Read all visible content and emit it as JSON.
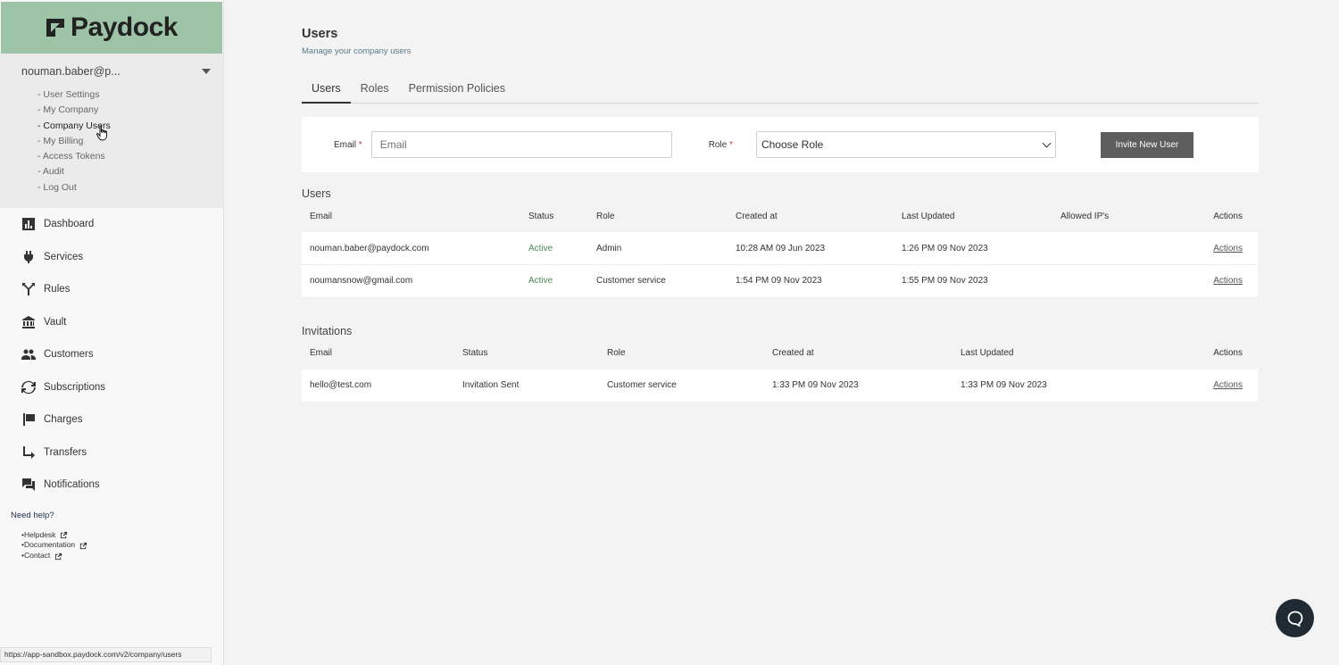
{
  "brand": {
    "name": "Paydock",
    "accent": "#9ec4a8"
  },
  "user": {
    "name": "nouman.baber@p...",
    "menu": [
      "- User Settings",
      "- My Company",
      "- Company Users",
      "- My Billing",
      "- Access Tokens",
      "- Audit",
      "- Log Out"
    ],
    "active_index": 2
  },
  "nav": [
    {
      "label": "Dashboard",
      "icon": "bar-chart-icon"
    },
    {
      "label": "Services",
      "icon": "plug-icon"
    },
    {
      "label": "Rules",
      "icon": "fork-icon"
    },
    {
      "label": "Vault",
      "icon": "bank-icon"
    },
    {
      "label": "Customers",
      "icon": "people-icon"
    },
    {
      "label": "Subscriptions",
      "icon": "refresh-icon"
    },
    {
      "label": "Charges",
      "icon": "flag-icon"
    },
    {
      "label": "Transfers",
      "icon": "transfer-arrow-icon"
    },
    {
      "label": "Notifications",
      "icon": "chat-bubbles-icon"
    }
  ],
  "help": {
    "title": "Need help?",
    "links": [
      "Helpdesk",
      "Documentation",
      "Contact"
    ]
  },
  "status_url": "https://app-sandbox.paydock.com/v2/company/users",
  "page": {
    "title": "Users",
    "subtitle": "Manage your company users",
    "tabs": [
      "Users",
      "Roles",
      "Permission Policies"
    ],
    "active_tab": 0
  },
  "invite": {
    "email_label": "Email",
    "email_placeholder": "Email",
    "role_label": "Role",
    "role_selected": "Choose Role",
    "button": "Invite New User"
  },
  "users": {
    "title": "Users",
    "columns": [
      "Email",
      "Status",
      "Role",
      "Created at",
      "Last Updated",
      "Allowed IP's",
      "Actions"
    ],
    "rows": [
      {
        "email": "nouman.baber@paydock.com",
        "status": "Active",
        "role": "Admin",
        "created": "10:28 AM 09 Jun 2023",
        "updated": "1:26 PM 09 Nov 2023",
        "ips": "",
        "action": "Actions"
      },
      {
        "email": "noumansnow@gmail.com",
        "status": "Active",
        "role": "Customer service",
        "created": "1:54 PM 09 Nov 2023",
        "updated": "1:55 PM 09 Nov 2023",
        "ips": "",
        "action": "Actions"
      }
    ]
  },
  "invitations": {
    "title": "Invitations",
    "columns": [
      "Email",
      "Status",
      "Role",
      "Created at",
      "Last Updated",
      "Actions"
    ],
    "rows": [
      {
        "email": "hello@test.com",
        "status": "Invitation Sent",
        "role": "Customer service",
        "created": "1:33 PM 09 Nov 2023",
        "updated": "1:33 PM 09 Nov 2023",
        "action": "Actions"
      }
    ]
  }
}
